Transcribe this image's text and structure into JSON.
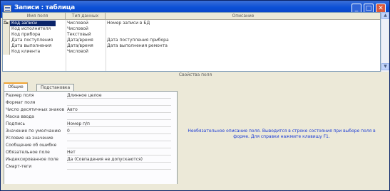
{
  "window": {
    "title": "Записи : таблица"
  },
  "grid": {
    "columns": [
      "Имя поля",
      "Тип данных",
      "Описание"
    ],
    "rows": [
      {
        "name": "Код записи",
        "type": "Числовой",
        "desc": "Номер записи в БД",
        "active": true
      },
      {
        "name": "Код исполнителя",
        "type": "Числовой",
        "desc": ""
      },
      {
        "name": "Код прибора",
        "type": "Текстовый",
        "desc": ""
      },
      {
        "name": "Дата поступления",
        "type": "Дата/время",
        "desc": "Дата поступления прибора"
      },
      {
        "name": "Дата выполнения",
        "type": "Дата/время",
        "desc": "Дата выполнения ремонта"
      },
      {
        "name": "Код клиента",
        "type": "Числовой",
        "desc": ""
      }
    ]
  },
  "props_bar": {
    "label": "Свойства поля"
  },
  "tabs": [
    "Общие",
    "Подстановка"
  ],
  "properties": [
    {
      "label": "Размер поля",
      "value": "Длинное целое"
    },
    {
      "label": "Формат поля",
      "value": ""
    },
    {
      "label": "Число десятичных знаков",
      "value": "Авто"
    },
    {
      "label": "Маска ввода",
      "value": ""
    },
    {
      "label": "Подпись",
      "value": "Номер п/п"
    },
    {
      "label": "Значение по умолчанию",
      "value": "0"
    },
    {
      "label": "Условие на значение",
      "value": ""
    },
    {
      "label": "Сообщение об ошибке",
      "value": ""
    },
    {
      "label": "Обязательное поле",
      "value": "Нет"
    },
    {
      "label": "Индексированное поле",
      "value": "Да (Совпадения не допускаются)"
    },
    {
      "label": "Смарт-теги",
      "value": ""
    }
  ],
  "hint": {
    "text": "Необязательное описание поля. Выводится в строке состояния при выборе поля в форме. Для справки нажмите клавишу F1."
  },
  "colors": {
    "title_bar": "#0b4fd6",
    "selection": "#0a246a",
    "hint_text": "#1a3bd6",
    "tab_highlight": "#f1a535"
  }
}
